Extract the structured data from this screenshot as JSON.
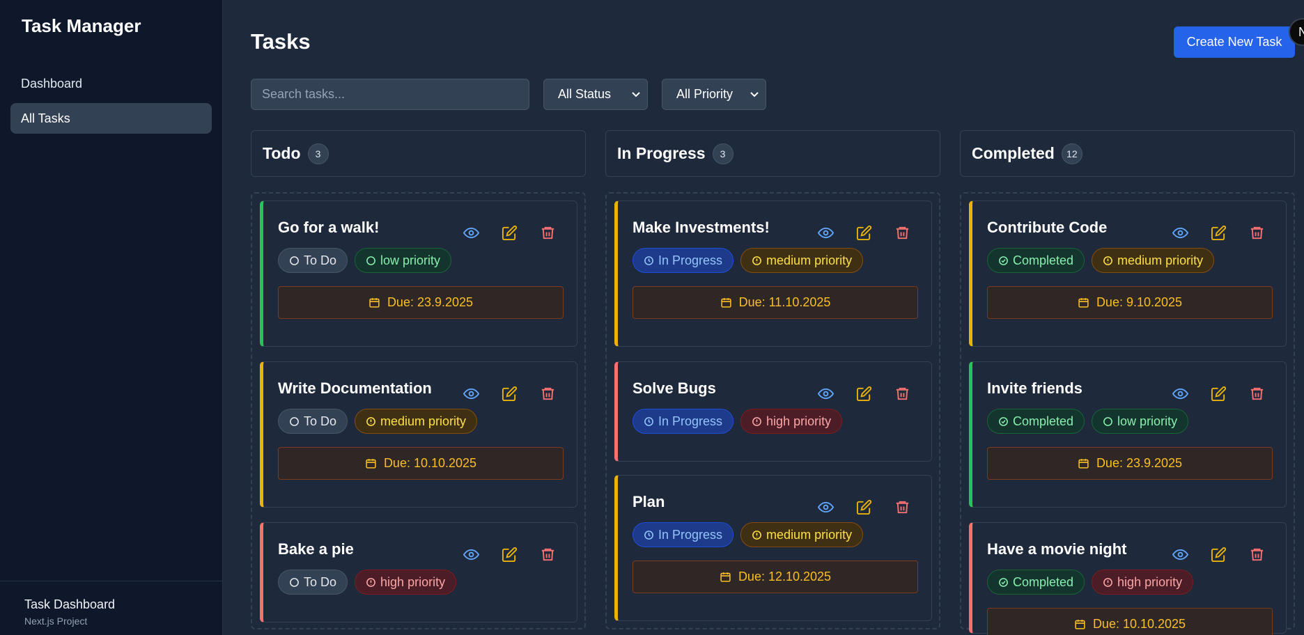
{
  "sidebar": {
    "brand": "Task Manager",
    "items": [
      {
        "label": "Dashboard",
        "active": false
      },
      {
        "label": "All Tasks",
        "active": true
      }
    ],
    "footer": {
      "title": "Task Dashboard",
      "subtitle": "Next.js Project"
    }
  },
  "header": {
    "title": "Tasks",
    "create_label": "Create New Task",
    "avatar_initial": "N"
  },
  "filters": {
    "search_placeholder": "Search tasks...",
    "status_value": "All Status",
    "priority_value": "All Priority"
  },
  "columns": [
    {
      "title": "Todo",
      "count": "3",
      "cards": [
        {
          "title": "Go for a walk!",
          "status": "To Do",
          "priority": "low priority",
          "due": "Due: 23.9.2025"
        },
        {
          "title": "Write Documentation",
          "status": "To Do",
          "priority": "medium priority",
          "due": "Due: 10.10.2025"
        },
        {
          "title": "Bake a pie",
          "status": "To Do",
          "priority": "high priority",
          "due": ""
        }
      ]
    },
    {
      "title": "In Progress",
      "count": "3",
      "cards": [
        {
          "title": "Make Investments!",
          "status": "In Progress",
          "priority": "medium priority",
          "due": "Due: 11.10.2025"
        },
        {
          "title": "Solve Bugs",
          "status": "In Progress",
          "priority": "high priority",
          "due": ""
        },
        {
          "title": "Plan",
          "status": "In Progress",
          "priority": "medium priority",
          "due": "Due: 12.10.2025"
        }
      ]
    },
    {
      "title": "Completed",
      "count": "12",
      "cards": [
        {
          "title": "Contribute Code",
          "status": "Completed",
          "priority": "medium priority",
          "due": "Due: 9.10.2025"
        },
        {
          "title": "Invite friends",
          "status": "Completed",
          "priority": "low priority",
          "due": "Due: 23.9.2025"
        },
        {
          "title": "Have a movie night",
          "status": "Completed",
          "priority": "high priority",
          "due": "Due: 10.10.2025"
        }
      ]
    }
  ],
  "colors": {
    "accent": "#2563eb",
    "low": "#22c55e",
    "medium": "#eab308",
    "high": "#f87171",
    "view_icon": "#60a5fa",
    "edit_icon": "#eab308",
    "delete_icon": "#f87171"
  },
  "icons": {
    "view": "eye-icon",
    "edit": "edit-icon",
    "delete": "trash-icon",
    "due": "calendar-icon",
    "status_todo": "circle-icon",
    "status_progress": "clock-icon",
    "status_completed": "check-circle-icon",
    "priority_low": "circle-icon",
    "priority_other": "alert-circle-icon"
  }
}
